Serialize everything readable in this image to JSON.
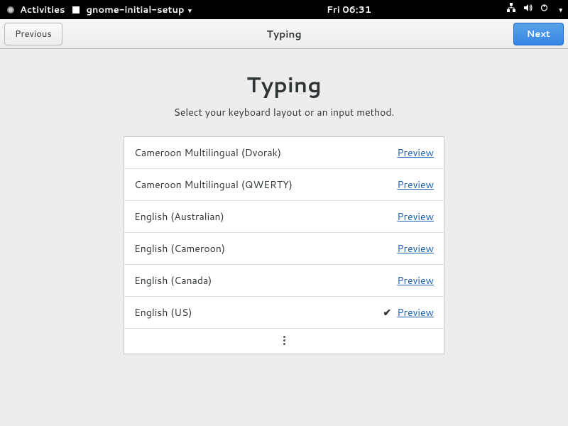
{
  "topbar": {
    "activities": "Activities",
    "app_name": "gnome-initial-setup",
    "clock": "Fri 06:31"
  },
  "headerbar": {
    "previous_label": "Previous",
    "next_label": "Next",
    "title": "Typing"
  },
  "page": {
    "heading": "Typing",
    "subtitle": "Select your keyboard layout or an input method."
  },
  "layouts": [
    {
      "name": "Cameroon Multilingual (Dvorak)",
      "selected": false,
      "preview": "Preview"
    },
    {
      "name": "Cameroon Multilingual (QWERTY)",
      "selected": false,
      "preview": "Preview"
    },
    {
      "name": "English (Australian)",
      "selected": false,
      "preview": "Preview"
    },
    {
      "name": "English (Cameroon)",
      "selected": false,
      "preview": "Preview"
    },
    {
      "name": "English (Canada)",
      "selected": false,
      "preview": "Preview"
    },
    {
      "name": "English (US)",
      "selected": true,
      "preview": "Preview"
    }
  ]
}
